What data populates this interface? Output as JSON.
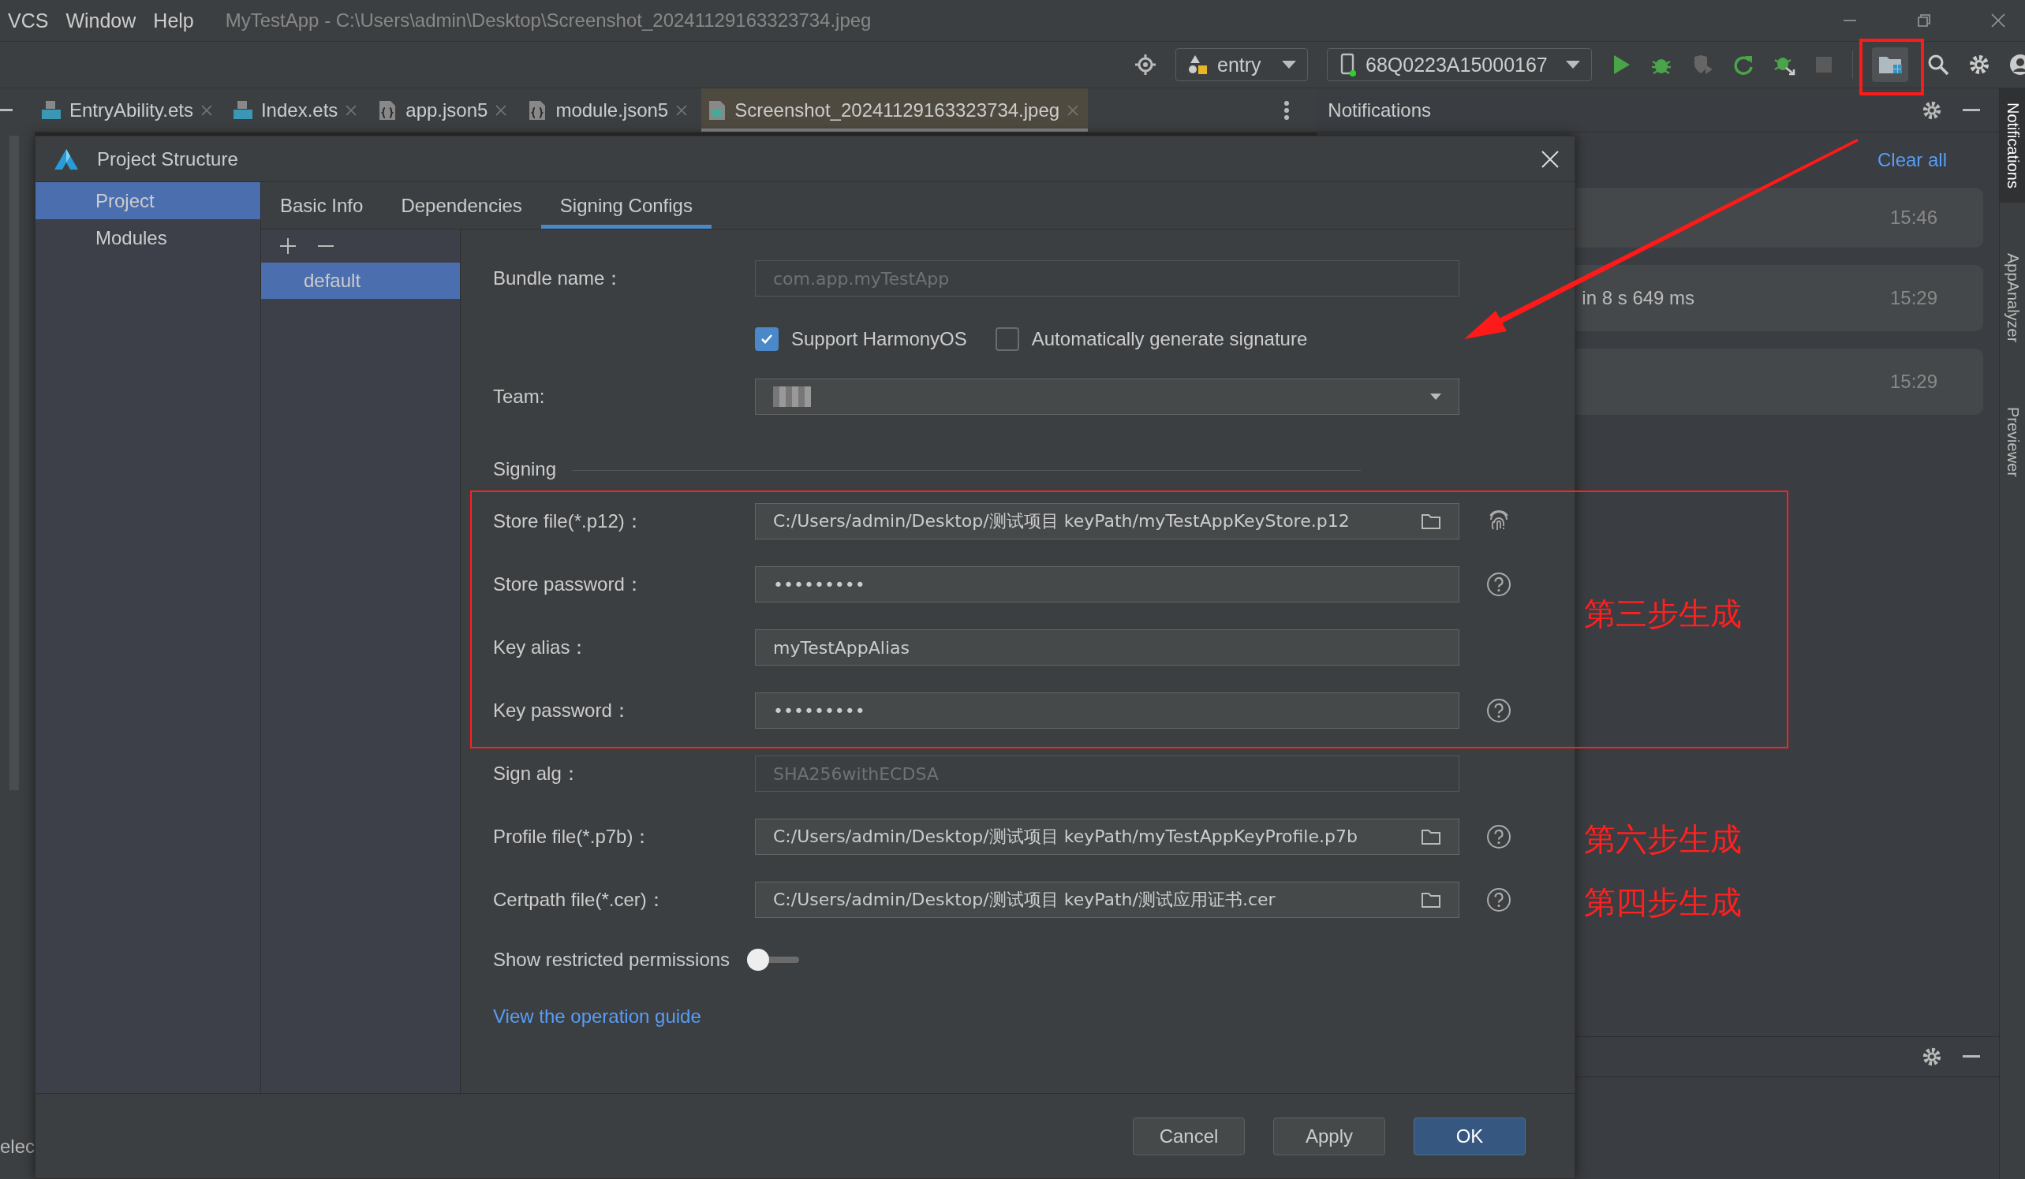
{
  "menu": [
    {
      "label": "VCS"
    },
    {
      "label": "Window"
    },
    {
      "label": "Help"
    }
  ],
  "window": {
    "title": "MyTestApp - C:\\Users\\admin\\Desktop\\Screenshot_20241129163323734.jpeg"
  },
  "toolbar": {
    "run_config": "entry",
    "device": "68Q0223A15000167"
  },
  "editor_tabs": [
    {
      "label": "EntryAbility.ets",
      "kind": "ets",
      "selected": false
    },
    {
      "label": "Index.ets",
      "kind": "ets",
      "selected": false
    },
    {
      "label": "app.json5",
      "kind": "json",
      "selected": false
    },
    {
      "label": "module.json5",
      "kind": "json",
      "selected": false
    },
    {
      "label": "Screenshot_20241129163323734.jpeg",
      "kind": "image",
      "selected": true
    }
  ],
  "left_edge_text": "elec",
  "notifications": {
    "title": "Notifications",
    "clear_all": "Clear all",
    "items": [
      {
        "time": "15:46"
      },
      {
        "text": "in 8 s 649 ms",
        "time": "15:29"
      },
      {
        "time": "15:29"
      }
    ]
  },
  "side_strip": [
    {
      "label": "Notifications",
      "selected": true
    },
    {
      "label": "AppAnalyzer",
      "selected": false
    },
    {
      "label": "Previewer",
      "selected": false
    }
  ],
  "dialog": {
    "title": "Project Structure",
    "nav": [
      {
        "label": "Project",
        "selected": true
      },
      {
        "label": "Modules",
        "selected": false
      }
    ],
    "tabs": [
      {
        "label": "Basic Info",
        "selected": false
      },
      {
        "label": "Dependencies",
        "selected": false
      },
      {
        "label": "Signing Configs",
        "selected": true
      }
    ],
    "configs": [
      {
        "label": "default",
        "selected": true
      }
    ],
    "form": {
      "rows_before": [
        {
          "kind": "field",
          "label": "Bundle name：",
          "value": "com.app.myTestApp",
          "disabled": true
        },
        {
          "kind": "checks",
          "items": [
            {
              "label": "Support HarmonyOS",
              "checked": true
            },
            {
              "label": "Automatically generate signature",
              "checked": false
            }
          ]
        },
        {
          "kind": "select",
          "label": "Team:"
        },
        {
          "kind": "section",
          "label": "Signing"
        }
      ],
      "marked_group": {
        "note": "第三步生成",
        "rows": [
          {
            "kind": "field",
            "label": "Store file(*.p12)：",
            "value": "C:/Users/admin/Desktop/测试项目 keyPath/myTestAppKeyStore.p12",
            "disabled": false,
            "browse": true,
            "fingerprint": true
          },
          {
            "kind": "field",
            "label": "Store password：",
            "value": "•••••••••",
            "disabled": false,
            "help": true
          },
          {
            "kind": "field",
            "label": "Key alias：",
            "value": "myTestAppAlias",
            "disabled": false
          },
          {
            "kind": "field",
            "label": "Key password：",
            "value": "•••••••••",
            "disabled": false,
            "help": true
          }
        ]
      },
      "rows_after": [
        {
          "kind": "field",
          "label": "Sign alg：",
          "value": "SHA256withECDSA",
          "disabled": true
        },
        {
          "kind": "field",
          "label": "Profile file(*.p7b)：",
          "value": "C:/Users/admin/Desktop/测试项目 keyPath/myTestAppKeyProfile.p7b",
          "disabled": false,
          "browse": true,
          "help": true,
          "note": "第六步生成"
        },
        {
          "kind": "field",
          "label": "Certpath file(*.cer)：",
          "value": "C:/Users/admin/Desktop/测试项目 keyPath/测试应用证书.cer",
          "disabled": false,
          "browse": true,
          "help": true,
          "note": "第四步生成"
        },
        {
          "kind": "toggle",
          "label": "Show restricted permissions",
          "on": false
        },
        {
          "kind": "link",
          "label": "View the operation guide"
        }
      ]
    },
    "buttons": [
      {
        "label": "Cancel",
        "kind": "default"
      },
      {
        "label": "Apply",
        "kind": "default"
      },
      {
        "label": "OK",
        "kind": "primary"
      }
    ]
  }
}
